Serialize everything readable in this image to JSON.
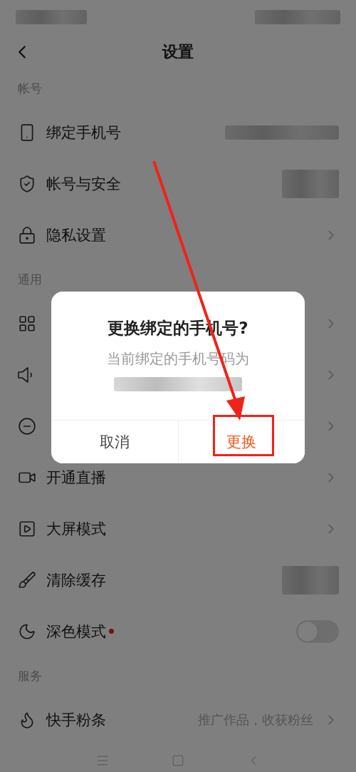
{
  "header": {
    "title": "设置"
  },
  "sections": [
    {
      "title": "帐号",
      "items": [
        {
          "label": "绑定手机号",
          "kind": "redacted"
        },
        {
          "label": "帐号与安全",
          "kind": "redacted"
        },
        {
          "label": "隐私设置",
          "kind": "chevron"
        }
      ]
    },
    {
      "title": "通用",
      "items": [
        {
          "kind": "chevron"
        },
        {
          "kind": "chevron"
        },
        {
          "kind": "chevron"
        },
        {
          "label": "开通直播",
          "kind": "chevron"
        },
        {
          "label": "大屏模式",
          "kind": "chevron"
        },
        {
          "label": "清除缓存",
          "kind": "redacted"
        },
        {
          "label": "深色模式",
          "kind": "toggle",
          "on": false,
          "badge": true
        }
      ]
    },
    {
      "title": "服务",
      "items": [
        {
          "label": "快手粉条",
          "kind": "chevron",
          "hint": "推广作品，收获粉丝"
        }
      ]
    }
  ],
  "dialog": {
    "title": "更换绑定的手机号?",
    "message": "当前绑定的手机号码为",
    "buttons": [
      {
        "label": "取消",
        "primary": false,
        "highlighted": false
      },
      {
        "label": "更换",
        "primary": true,
        "highlighted": true
      }
    ]
  }
}
